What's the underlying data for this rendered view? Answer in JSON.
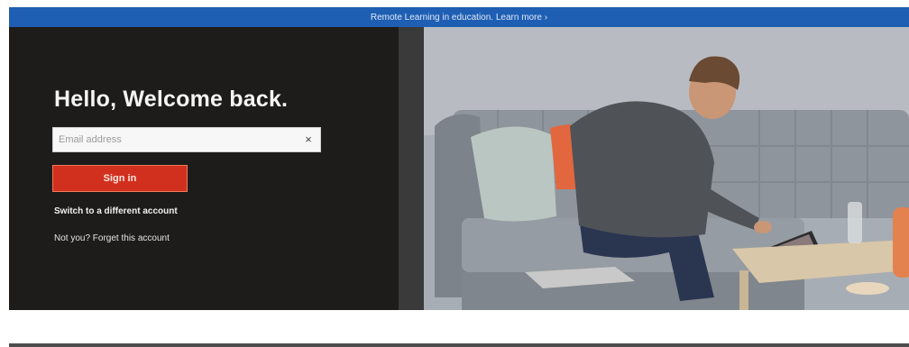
{
  "banner": {
    "text": "Remote Learning in education. Learn more ›"
  },
  "signin_panel": {
    "greeting": "Hello, Welcome back.",
    "email_placeholder": "Email address",
    "clear_symbol": "×",
    "signin_label": "Sign in",
    "switch_account_label": "Switch to a different account",
    "forget_account_label": "Not you? Forget this account"
  },
  "hero_image": {
    "subject": "man-on-sofa-using-tablet"
  },
  "colors": {
    "banner": "#1f5fb3",
    "panel": "#1d1c1a",
    "signin_button": "#d2301e"
  }
}
